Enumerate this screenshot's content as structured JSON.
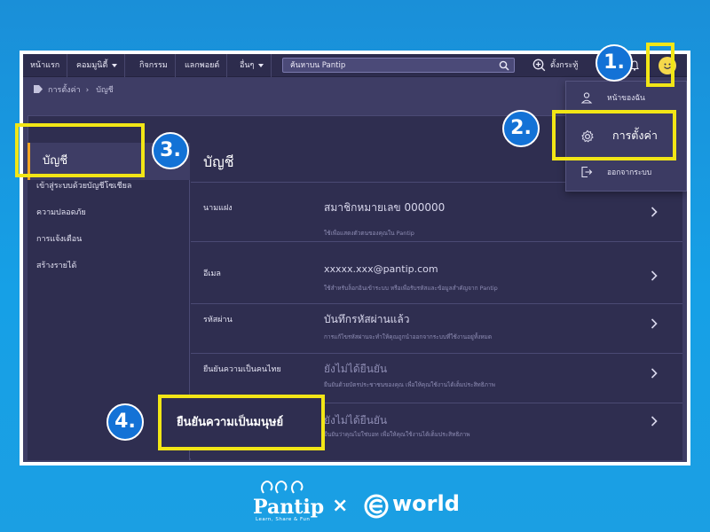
{
  "nav": {
    "items": [
      "หน้าแรก",
      "คอมมูนิตี้",
      "กิจกรรม",
      "แลกพอยต์",
      "อื่นๆ"
    ],
    "search_placeholder": "ค้นหาบน Pantip",
    "create_topic": "ตั้งกระทู้"
  },
  "breadcrumb": [
    "การตั้งค่า",
    "บัญชี"
  ],
  "dropdown": {
    "items": [
      "หน้าของฉัน",
      "การตั้งค่า",
      "ออกจากระบบ"
    ]
  },
  "sidebar": {
    "active": "บัญชี",
    "items": [
      "เข้าสู่ระบบด้วยบัญชีโซเชียล",
      "ความปลอดภัย",
      "การแจ้งเตือน",
      "สร้างรายได้"
    ]
  },
  "panel": {
    "title": "บัญชี",
    "rows": [
      {
        "label": "นามแฝง",
        "value": "สมาชิกหมายเลข 000000",
        "desc": "ใช้เพื่อแสดงตัวตนของคุณใน Pantip"
      },
      {
        "label": "อีเมล",
        "value": "xxxxx.xxx@pantip.com",
        "desc": "ใช้สำหรับล็อกอินเข้าระบบ หรือเพื่อรับรหัสและข้อมูลสำคัญจาก Pantip"
      },
      {
        "label": "รหัสผ่าน",
        "value": "บันทึกรหัสผ่านแล้ว",
        "desc": "การแก้ไขรหัสผ่านจะทำให้คุณถูกนำออกจากระบบที่ใช้งานอยู่ทั้งหมด"
      },
      {
        "label": "ยืนยันความเป็นคนไทย",
        "value": "ยังไม่ได้ยืนยัน",
        "desc": "ยืนยันด้วยบัตรประชาชนของคุณ เพื่อให้คุณใช้งานได้เต็มประสิทธิภาพ"
      },
      {
        "label": "ยืนยันความเป็นมนุษย์",
        "value": "ยังไม่ได้ยืนยัน",
        "desc": "ยืนยันว่าคุณไม่ใช่บอท เพื่อให้คุณใช้งานได้เต็มประสิทธิภาพ"
      }
    ]
  },
  "annotations": [
    "1.",
    "2.",
    "3.",
    "4."
  ],
  "footer": {
    "pantip": "Pantip",
    "tagline": "Learn, Share & Fun",
    "times": "×",
    "eworld": "world"
  },
  "colors": {
    "background": "#1a8fd8",
    "app_bg": "#2f2e50",
    "highlight": "#f2e616",
    "badge": "#1372d6",
    "avatar": "#f5d84b"
  }
}
